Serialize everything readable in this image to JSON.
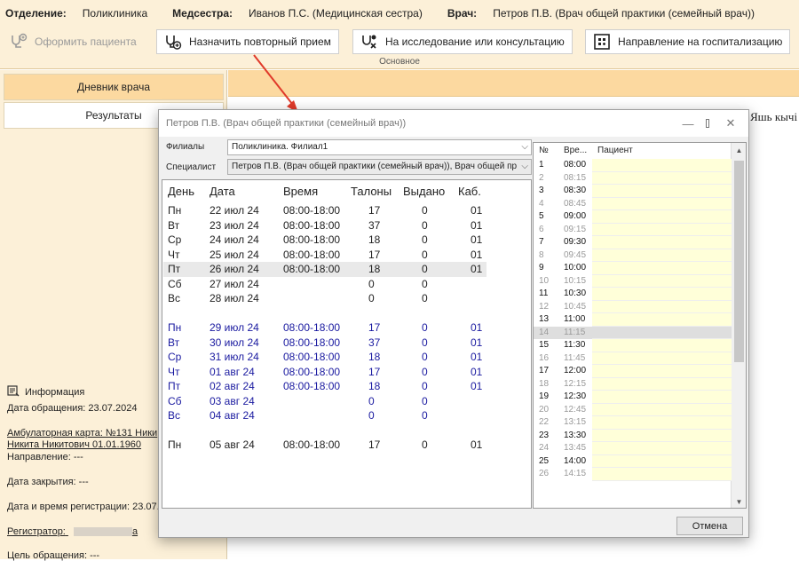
{
  "header": {
    "dept_label": "Отделение:",
    "dept_value": "Поликлиника",
    "nurse_label": "Медсестра:",
    "nurse_value": "Иванов П.С. (Медицинская сестра)",
    "doctor_label": "Врач:",
    "doctor_value": "Петров П.В. (Врач общей практики (семейный врач))"
  },
  "toolbar": {
    "register_label": "Оформить пациента",
    "repeat_label": "Назначить повторный прием",
    "research_label": "На исследование или консультацию",
    "hosp_label": "Направление на госпитализацию",
    "group_label": "Основное"
  },
  "left": {
    "tab_diary": "Дневник врача",
    "tab_results": "Результаты",
    "info_title": "Информация",
    "visit_date": "Дата обращения: 23.07.2024",
    "card_line1": "Амбулаторная карта: №131 Ники",
    "card_line2": "Никита Никитович 01.01.1960",
    "direction": "Направление: ---",
    "close_date": "Дата закрытия: ---",
    "reg_datetime": "Дата и время регистрации: 23.07.",
    "registrar_label": "Регистратор:",
    "registrar_tail": "а",
    "purpose": "Цель обращения: ---"
  },
  "main": {
    "side_text": "Яшь кычі"
  },
  "dialog": {
    "title": "Петров П.В. (Врач общей практики (семейный врач))",
    "branch_label": "Филиалы",
    "branch_value": "Поликлиника. Филиал1",
    "spec_label": "Специалист",
    "spec_value": "Петров П.В. (Врач общей практики (семейный врач)), Врач общей пр",
    "columns": [
      "День",
      "Дата",
      "Время",
      "Талоны",
      "Выдано",
      "Каб."
    ],
    "rows": [
      {
        "day": "Пн",
        "date": "22 июл 24",
        "time": "08:00-18:00",
        "tickets": "17",
        "issued": "0",
        "room": "01",
        "week": 1
      },
      {
        "day": "Вт",
        "date": "23 июл 24",
        "time": "08:00-18:00",
        "tickets": "37",
        "issued": "0",
        "room": "01",
        "week": 1
      },
      {
        "day": "Ср",
        "date": "24 июл 24",
        "time": "08:00-18:00",
        "tickets": "18",
        "issued": "0",
        "room": "01",
        "week": 1
      },
      {
        "day": "Чт",
        "date": "25 июл 24",
        "time": "08:00-18:00",
        "tickets": "17",
        "issued": "0",
        "room": "01",
        "week": 1
      },
      {
        "day": "Пт",
        "date": "26 июл 24",
        "time": "08:00-18:00",
        "tickets": "18",
        "issued": "0",
        "room": "01",
        "week": 1,
        "selected": true
      },
      {
        "day": "Сб",
        "date": "27 июл 24",
        "time": "",
        "tickets": "0",
        "issued": "0",
        "room": "",
        "week": 1
      },
      {
        "day": "Вс",
        "date": "28 июл 24",
        "time": "",
        "tickets": "0",
        "issued": "0",
        "room": "",
        "week": 1
      },
      {
        "day": "Пн",
        "date": "29 июл 24",
        "time": "08:00-18:00",
        "tickets": "17",
        "issued": "0",
        "room": "01",
        "week": 2
      },
      {
        "day": "Вт",
        "date": "30 июл 24",
        "time": "08:00-18:00",
        "tickets": "37",
        "issued": "0",
        "room": "01",
        "week": 2
      },
      {
        "day": "Ср",
        "date": "31 июл 24",
        "time": "08:00-18:00",
        "tickets": "18",
        "issued": "0",
        "room": "01",
        "week": 2
      },
      {
        "day": "Чт",
        "date": "01 авг 24",
        "time": "08:00-18:00",
        "tickets": "17",
        "issued": "0",
        "room": "01",
        "week": 2
      },
      {
        "day": "Пт",
        "date": "02 авг 24",
        "time": "08:00-18:00",
        "tickets": "18",
        "issued": "0",
        "room": "01",
        "week": 2
      },
      {
        "day": "Сб",
        "date": "03 авг 24",
        "time": "",
        "tickets": "0",
        "issued": "0",
        "room": "",
        "week": 2
      },
      {
        "day": "Вс",
        "date": "04 авг 24",
        "time": "",
        "tickets": "0",
        "issued": "0",
        "room": "",
        "week": 2
      },
      {
        "day": "Пн",
        "date": "05 авг 24",
        "time": "08:00-18:00",
        "tickets": "17",
        "issued": "0",
        "room": "01",
        "week": 3
      }
    ],
    "slot_columns": [
      "№",
      "Вре...",
      "Пациент"
    ],
    "slots": [
      {
        "n": "1",
        "t": "08:00",
        "dim": false
      },
      {
        "n": "2",
        "t": "08:15",
        "dim": true
      },
      {
        "n": "3",
        "t": "08:30",
        "dim": false
      },
      {
        "n": "4",
        "t": "08:45",
        "dim": true
      },
      {
        "n": "5",
        "t": "09:00",
        "dim": false
      },
      {
        "n": "6",
        "t": "09:15",
        "dim": true
      },
      {
        "n": "7",
        "t": "09:30",
        "dim": false
      },
      {
        "n": "8",
        "t": "09:45",
        "dim": true
      },
      {
        "n": "9",
        "t": "10:00",
        "dim": false
      },
      {
        "n": "10",
        "t": "10:15",
        "dim": true
      },
      {
        "n": "11",
        "t": "10:30",
        "dim": false
      },
      {
        "n": "12",
        "t": "10:45",
        "dim": true
      },
      {
        "n": "13",
        "t": "11:00",
        "dim": false
      },
      {
        "n": "14",
        "t": "11:15",
        "dim": true,
        "hl": true
      },
      {
        "n": "15",
        "t": "11:30",
        "dim": false
      },
      {
        "n": "16",
        "t": "11:45",
        "dim": true
      },
      {
        "n": "17",
        "t": "12:00",
        "dim": false
      },
      {
        "n": "18",
        "t": "12:15",
        "dim": true
      },
      {
        "n": "19",
        "t": "12:30",
        "dim": false
      },
      {
        "n": "20",
        "t": "12:45",
        "dim": true
      },
      {
        "n": "22",
        "t": "13:15",
        "dim": true
      },
      {
        "n": "23",
        "t": "13:30",
        "dim": false
      },
      {
        "n": "24",
        "t": "13:45",
        "dim": true
      },
      {
        "n": "25",
        "t": "14:00",
        "dim": false
      },
      {
        "n": "26",
        "t": "14:15",
        "dim": true
      }
    ],
    "cancel_label": "Отмена"
  },
  "colors": {
    "accent_bg": "#fcf0d8",
    "tab_active": "#fcd9a0",
    "week2_text": "#1a1aa0",
    "arrow": "#e03a2a",
    "slot_bg": "#ffffd9"
  }
}
